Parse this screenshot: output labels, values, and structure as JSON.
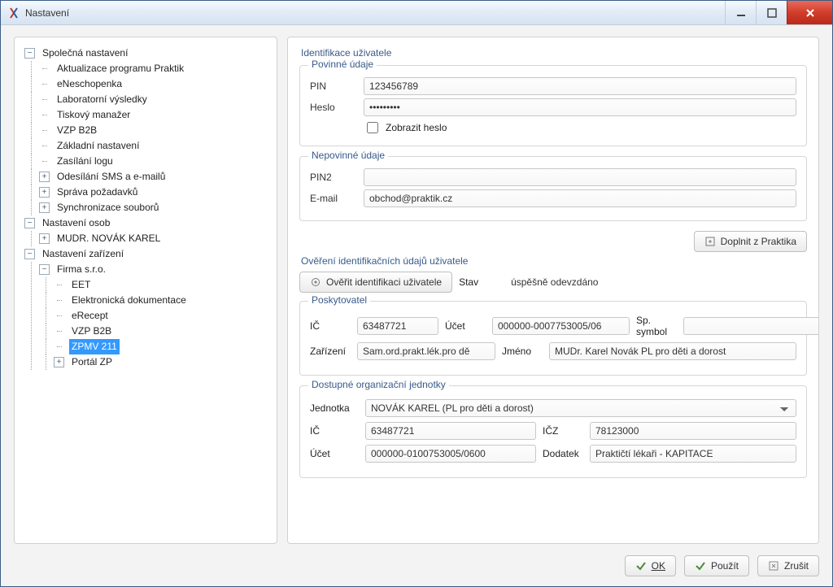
{
  "window": {
    "title": "Nastavení"
  },
  "tree": {
    "n0": "Společná nastavení",
    "n0_0": "Aktualizace programu Praktik",
    "n0_1": "eNeschopenka",
    "n0_2": "Laboratorní výsledky",
    "n0_3": "Tiskový manažer",
    "n0_4": "VZP B2B",
    "n0_5": "Základní nastavení",
    "n0_6": "Zasílání logu",
    "n0_7": "Odesílání SMS a e-mailů",
    "n0_8": "Správa požadavků",
    "n0_9": "Synchronizace souborů",
    "n1": "Nastavení osob",
    "n1_0": "MUDR. NOVÁK KAREL",
    "n2": "Nastavení zařízení",
    "n2_0": "Firma s.r.o.",
    "n2_0_0": "EET",
    "n2_0_1": "Elektronická dokumentace",
    "n2_0_2": "eRecept",
    "n2_0_3": "VZP B2B",
    "n2_0_4": "ZPMV 211",
    "n2_0_5": "Portál ZP"
  },
  "sections": {
    "ident": "Identifikace uživatele",
    "povinne": "Povinné údaje",
    "nepovinne": "Nepovinné údaje",
    "overeni": "Ověření identifikačních údajů uživatele",
    "poskytovatel": "Poskytovatel",
    "jednotky": "Dostupné organizační jednotky"
  },
  "labels": {
    "pin": "PIN",
    "heslo": "Heslo",
    "zobrazit": "Zobrazit heslo",
    "pin2": "PIN2",
    "email": "E-mail",
    "doplnit": "Doplnit z Praktika",
    "overit": "Ověřit identifikaci uživatele",
    "stav": "Stav",
    "ic": "IČ",
    "ucet": "Účet",
    "sp": "Sp. symbol",
    "zarizeni": "Zařízení",
    "jmeno": "Jméno",
    "jednotka": "Jednotka",
    "icz": "IČZ",
    "dodatek": "Dodatek",
    "ok": "OK",
    "pouzit": "Použít",
    "zrusit": "Zrušit"
  },
  "values": {
    "pin": "123456789",
    "heslo": "•••••••••",
    "pin2": "",
    "email": "obchod@praktik.cz",
    "stav": "úspěšně odevzdáno",
    "posk_ic": "63487721",
    "posk_ucet": "000000-0007753005/06",
    "posk_sp": "",
    "posk_zar": "Sam.ord.prakt.lék.pro dě",
    "posk_jmeno": "MUDr. Karel Novák PL pro děti a dorost",
    "jednotka_sel": "NOVÁK KAREL (PL pro děti a dorost)",
    "jed_ic": "63487721",
    "jed_icz": "78123000",
    "jed_ucet": "000000-0100753005/0600",
    "jed_dodatek": "Praktičtí lékaři - KAPITACE"
  }
}
